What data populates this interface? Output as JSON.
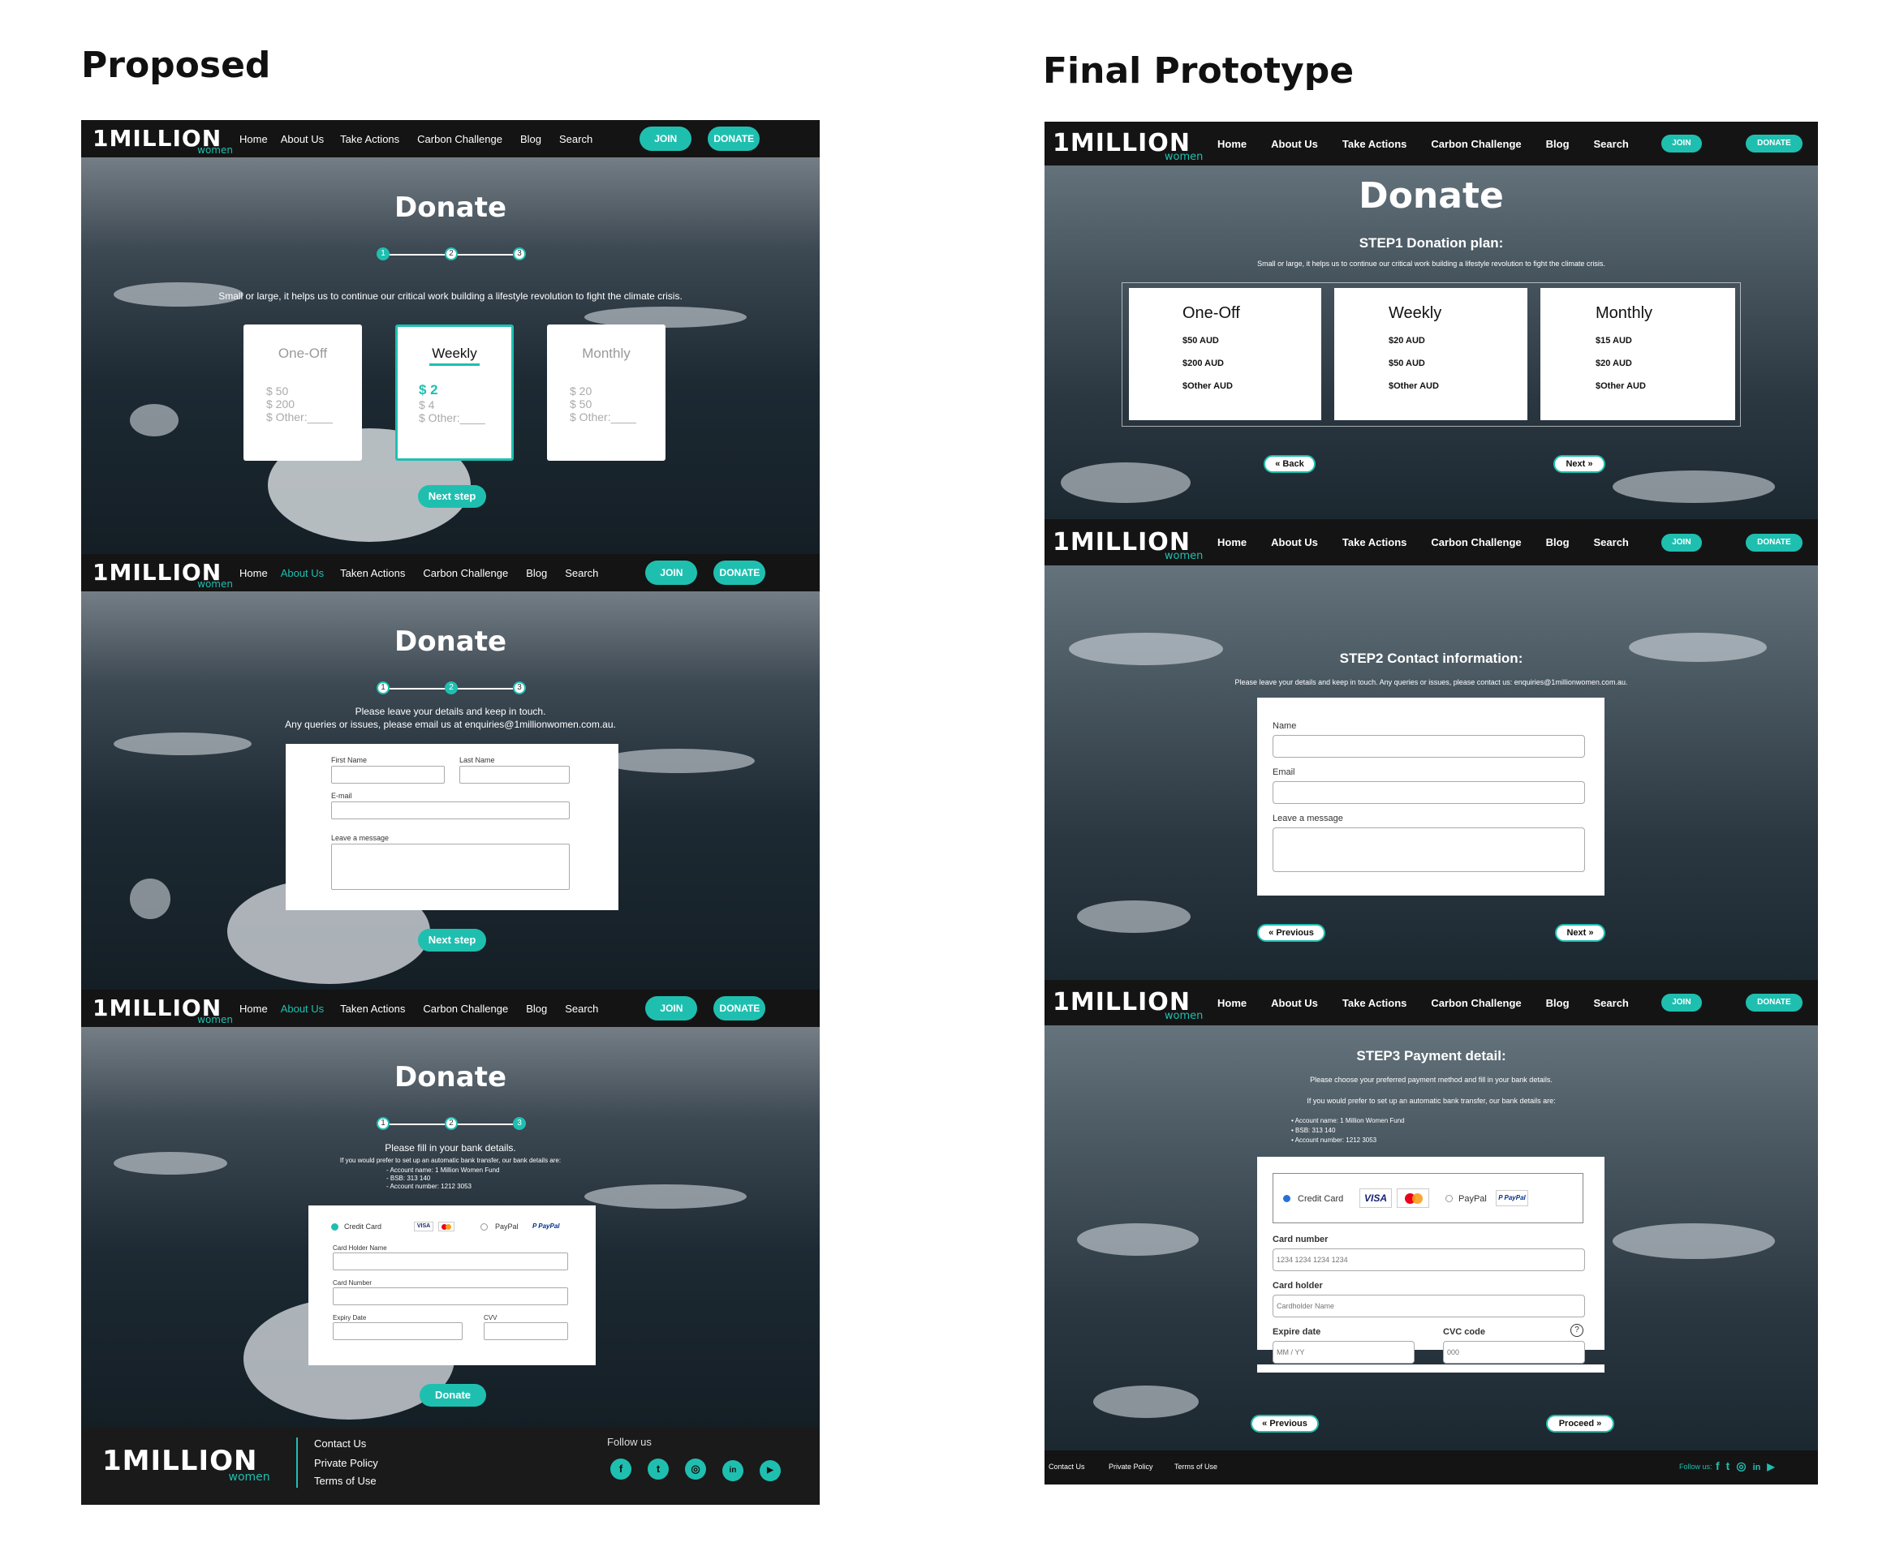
{
  "headings": {
    "proposed": "Proposed",
    "final": "Final Prototype"
  },
  "logo": {
    "main": "1MILLI",
    "o": "O",
    "n": "N",
    "sub": "women"
  },
  "nav": {
    "home": "Home",
    "about": "About Us",
    "take": "Take Actions",
    "taken": "Taken Actions",
    "carbon": "Carbon Challenge",
    "blog": "Blog",
    "search": "Search",
    "join": "JOIN",
    "donate": "DONATE"
  },
  "proposed": {
    "title": "Donate",
    "steps": [
      "1",
      "2",
      "3"
    ],
    "step1": {
      "intro": "Small or large, it helps us to continue our critical work building a lifestyle revolution to fight the climate crisis.",
      "plans": [
        {
          "name": "One-Off",
          "amounts": [
            "$ 50",
            "$ 200",
            "$ Other:____"
          ]
        },
        {
          "name": "Weekly",
          "amounts": [
            "$ 2",
            "$ 4",
            "$ Other:____"
          ]
        },
        {
          "name": "Monthly",
          "amounts": [
            "$ 20",
            "$ 50",
            "$ Other:____"
          ]
        }
      ],
      "next": "Next step"
    },
    "step2": {
      "intro1": "Please leave your details and keep in touch.",
      "intro2": "Any queries or issues, please email us at enquiries@1millionwomen.com.au.",
      "first": "First Name",
      "last": "Last Name",
      "email": "E-mail",
      "message": "Leave a message",
      "next": "Next step"
    },
    "step3": {
      "intro": "Please fill in your bank details.",
      "bank_intro": "If you would prefer to set up an automatic bank transfer, our bank details are:",
      "bank": [
        "- Account name: 1 Million Women Fund",
        "- BSB: 313 140",
        "- Account number: 1212 3053"
      ],
      "credit": "Credit Card",
      "paypal": "PayPal",
      "holder": "Card Holder Name",
      "number": "Card Number",
      "expiry": "Expiry Date",
      "cvv": "CVV",
      "donate": "Donate"
    },
    "footer": {
      "contact": "Contact Us",
      "privacy": "Private Policy",
      "terms": "Terms of Use",
      "follow": "Follow us"
    }
  },
  "final": {
    "step1": {
      "title": "Donate",
      "heading": "STEP1 Donation plan:",
      "intro": "Small or large, it helps us to continue our critical work building a lifestyle revolution to fight the climate crisis.",
      "plans": [
        {
          "name": "One-Off",
          "amounts": [
            "$50 AUD",
            "$200 AUD",
            "$Other AUD"
          ]
        },
        {
          "name": "Weekly",
          "amounts": [
            "$20 AUD",
            "$50 AUD",
            "$Other AUD"
          ]
        },
        {
          "name": "Monthly",
          "amounts": [
            "$15 AUD",
            "$20 AUD",
            "$Other AUD"
          ]
        }
      ],
      "back": "« Back",
      "next": "Next »"
    },
    "step2": {
      "heading": "STEP2 Contact information:",
      "intro": "Please leave your details and keep in touch. Any queries or issues, please contact us: enquiries@1millionwomen.com.au.",
      "name": "Name",
      "email": "Email",
      "message": "Leave a message",
      "prev": "« Previous",
      "next": "Next »"
    },
    "step3": {
      "heading": "STEP3 Payment detail:",
      "intro": "Please choose your preferred payment method and fill in your bank details.",
      "bank_intro": "If you would prefer to set up an automatic bank transfer, our bank details are:",
      "bank": [
        "Account name: 1 Million Women Fund",
        "BSB: 313 140",
        "Account number: 1212 3053"
      ],
      "credit": "Credit Card",
      "paypal": "PayPal",
      "card_number": "Card number",
      "card_number_ph": "1234 1234 1234 1234",
      "holder": "Card holder",
      "holder_ph": "Cardholder Name",
      "expire": "Expire date",
      "expire_ph": "MM / YY",
      "cvc": "CVC code",
      "cvc_ph": "000",
      "prev": "« Previous",
      "proceed": "Proceed »"
    },
    "footer": {
      "contact": "Contact Us",
      "privacy": "Private Policy",
      "terms": "Terms of Use",
      "follow": "Follow us:"
    }
  },
  "icons": {
    "facebook": "f",
    "twitter": "t",
    "instagram": "◎",
    "linkedin": "in",
    "youtube": "▶"
  },
  "colors": {
    "accent": "#1fbfb0",
    "nav": "#141414"
  }
}
